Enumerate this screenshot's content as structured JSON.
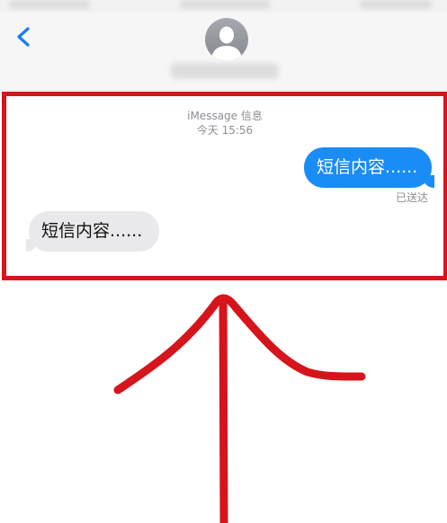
{
  "nav": {
    "back_icon": "chevron-left-icon",
    "avatar_icon": "person-silhouette-icon"
  },
  "thread": {
    "service_label": "iMessage 信息",
    "timestamp": "今天 15:56",
    "messages": [
      {
        "direction": "sent",
        "text": "短信内容......",
        "status": "已送达"
      },
      {
        "direction": "received",
        "text": "短信内容......"
      }
    ]
  },
  "colors": {
    "sent_bubble": "#1a8cf5",
    "received_bubble": "#e9e9eb",
    "annotation_red": "#d6141b",
    "ios_blue": "#1a7cf0"
  }
}
